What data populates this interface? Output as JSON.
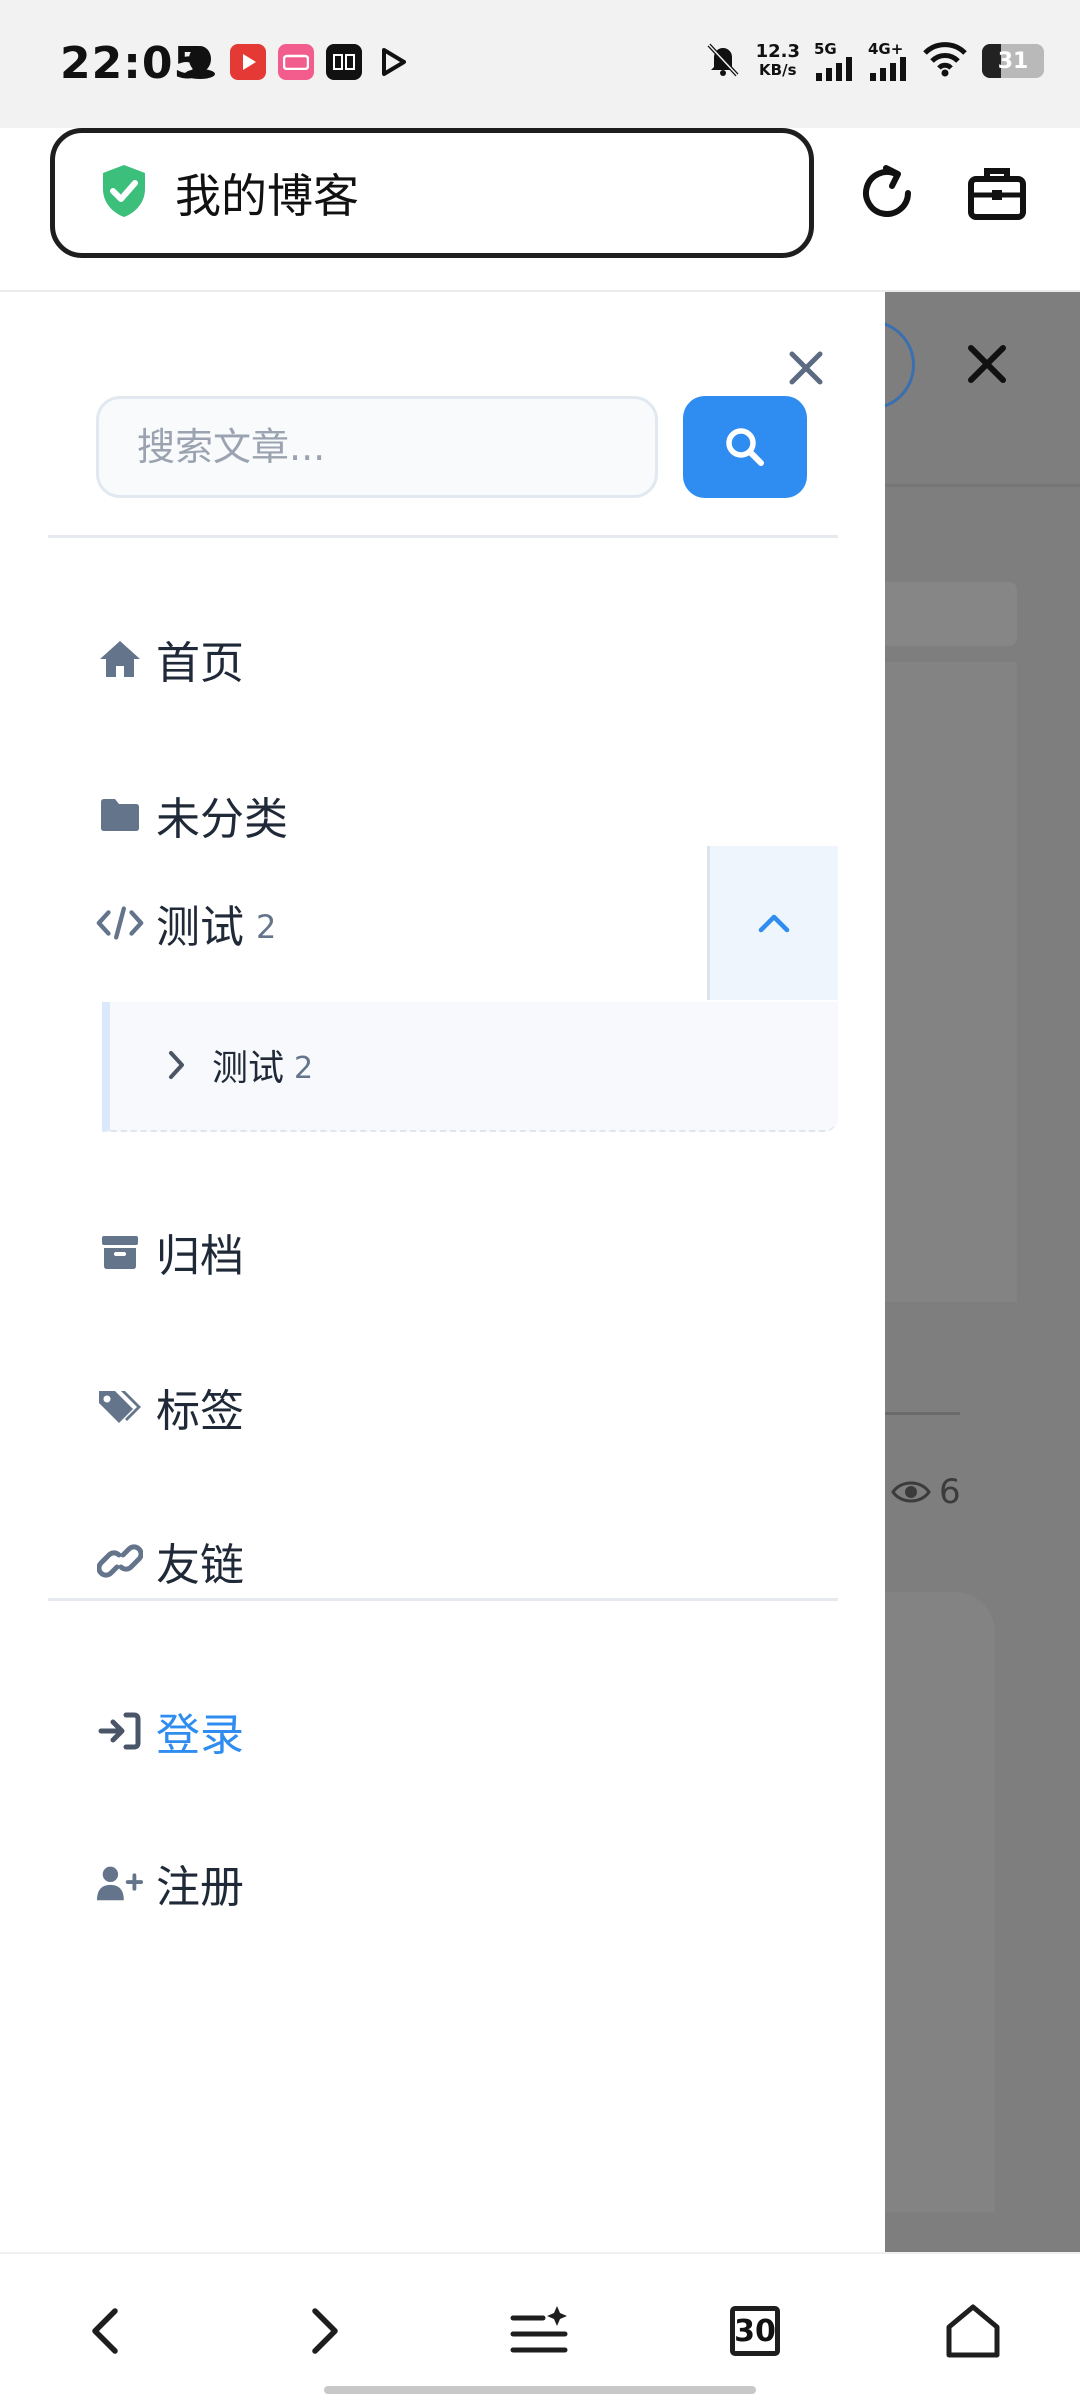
{
  "status_bar": {
    "time": "22:05",
    "net_speed_value": "12.3",
    "net_speed_unit": "KB/s",
    "sim1": "5G",
    "sim2": "4G+",
    "battery": "31",
    "apps": [
      "qq-icon",
      "video-app-icon",
      "bilibili-icon",
      "dewu-icon",
      "play-icon"
    ]
  },
  "browser": {
    "url_text": "我的博客",
    "secure_icon": "shield-check-icon",
    "reload_icon": "reload-icon",
    "toolbox_icon": "toolbox-icon",
    "tab_count": "30"
  },
  "drawer": {
    "search": {
      "placeholder": "搜索文章..."
    },
    "nav": [
      {
        "label": "首页",
        "icon": "home-icon"
      },
      {
        "label": "未分类",
        "icon": "folder-icon"
      },
      {
        "label": "测试",
        "count": "2",
        "icon": "code-icon",
        "expanded": true
      },
      {
        "label": "归档",
        "icon": "archive-icon"
      },
      {
        "label": "标签",
        "icon": "tags-icon"
      },
      {
        "label": "友链",
        "icon": "link-icon"
      }
    ],
    "submenu": [
      {
        "label": "测试",
        "count": "2"
      }
    ],
    "auth": [
      {
        "label": "登录",
        "icon": "sign-in-icon"
      },
      {
        "label": "注册",
        "icon": "user-plus-icon"
      }
    ]
  },
  "background_page": {
    "view_count": "6"
  },
  "colors": {
    "accent": "#2f8cf0",
    "secure_green": "#3bbf7a",
    "icon_gray": "#64748b",
    "overlay": "#7e7e7e"
  }
}
